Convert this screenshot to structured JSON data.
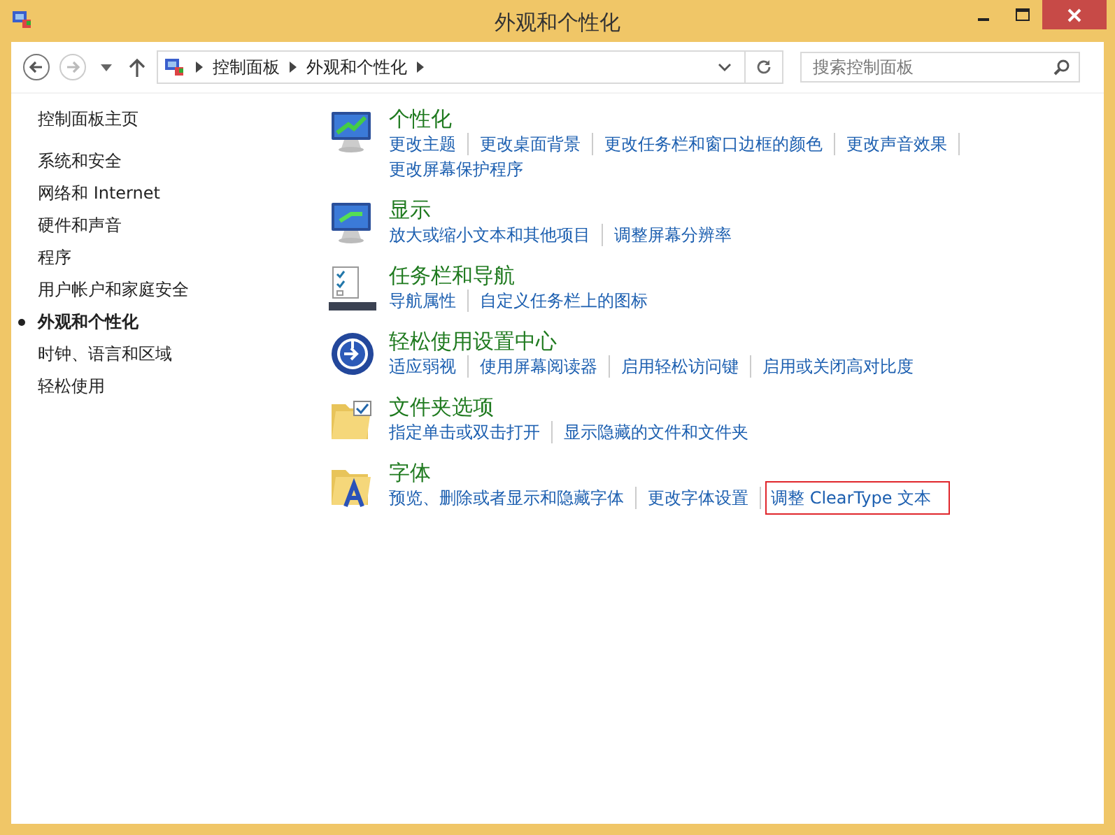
{
  "window": {
    "title": "外观和个性化"
  },
  "address_bar": {
    "crumbs": [
      "控制面板",
      "外观和个性化"
    ]
  },
  "search": {
    "placeholder": "搜索控制面板"
  },
  "sidebar": {
    "home": "控制面板主页",
    "items": [
      {
        "label": "系统和安全",
        "selected": false
      },
      {
        "label": "网络和 Internet",
        "selected": false
      },
      {
        "label": "硬件和声音",
        "selected": false
      },
      {
        "label": "程序",
        "selected": false
      },
      {
        "label": "用户帐户和家庭安全",
        "selected": false
      },
      {
        "label": "外观和个性化",
        "selected": true
      },
      {
        "label": "时钟、语言和区域",
        "selected": false
      },
      {
        "label": "轻松使用",
        "selected": false
      }
    ]
  },
  "sections": [
    {
      "title": "个性化",
      "links": [
        {
          "label": "更改主题",
          "highlighted": false
        },
        {
          "label": "更改桌面背景",
          "highlighted": false
        },
        {
          "label": "更改任务栏和窗口边框的颜色",
          "highlighted": false
        },
        {
          "label": "更改声音效果",
          "highlighted": false
        },
        {
          "label": "更改屏幕保护程序",
          "highlighted": false
        }
      ]
    },
    {
      "title": "显示",
      "links": [
        {
          "label": "放大或缩小文本和其他项目",
          "highlighted": false
        },
        {
          "label": "调整屏幕分辨率",
          "highlighted": false
        }
      ]
    },
    {
      "title": "任务栏和导航",
      "links": [
        {
          "label": "导航属性",
          "highlighted": false
        },
        {
          "label": "自定义任务栏上的图标",
          "highlighted": false
        }
      ]
    },
    {
      "title": "轻松使用设置中心",
      "links": [
        {
          "label": "适应弱视",
          "highlighted": false
        },
        {
          "label": "使用屏幕阅读器",
          "highlighted": false
        },
        {
          "label": "启用轻松访问键",
          "highlighted": false
        },
        {
          "label": "启用或关闭高对比度",
          "highlighted": false
        }
      ]
    },
    {
      "title": "文件夹选项",
      "links": [
        {
          "label": "指定单击或双击打开",
          "highlighted": false
        },
        {
          "label": "显示隐藏的文件和文件夹",
          "highlighted": false
        }
      ]
    },
    {
      "title": "字体",
      "links": [
        {
          "label": "预览、删除或者显示和隐藏字体",
          "highlighted": false
        },
        {
          "label": "更改字体设置",
          "highlighted": false
        },
        {
          "label": "调整 ClearType 文本",
          "highlighted": true
        }
      ]
    }
  ]
}
